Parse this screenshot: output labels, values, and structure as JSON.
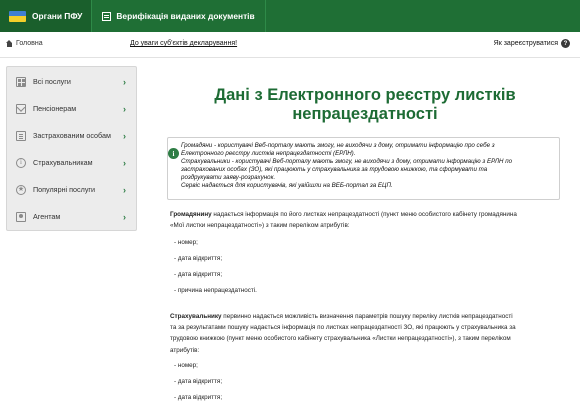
{
  "header": {
    "brand": "Органи ПФУ",
    "nav_item": "Верифікація виданих документів"
  },
  "subbar": {
    "home": "Головна",
    "notice": "До уваги суб'єктів декларування!",
    "register": "Як зареєструватися",
    "help_glyph": "?"
  },
  "sidebar": {
    "items": [
      {
        "label": "Всі послуги",
        "icon": "grid-icon"
      },
      {
        "label": "Пенсіонерам",
        "icon": "envelope-icon"
      },
      {
        "label": "Застрахованим особам",
        "icon": "document-icon"
      },
      {
        "label": "Страхувальникам",
        "icon": "info-icon"
      },
      {
        "label": "Популярні послуги",
        "icon": "star-icon"
      },
      {
        "label": "Агентам",
        "icon": "user-icon"
      }
    ],
    "chevron": "›"
  },
  "main": {
    "title_line1": "Дані з Електронного реєстру листків",
    "title_line2": "непрацездатності",
    "info_icon": "i",
    "info_lines": [
      "Громадяни - користувачі Веб-порталу мають змогу, не виходячи з дому, отримати інформацію про себе з",
      "Електронного реєстру листків непрацездатності (ЕРЛН).",
      "Страхувальники - користувачі Веб-порталу мають змогу, не виходячи з дому, отримати інформацію з ЕРЛН по",
      "застрахованих особах (ЗО), які працюють у страхувальника за трудовою книжкою, та сформувати та",
      "роздрукувати заяву-розрахунок.",
      "Сервіс надається для користувачів, які увійшли на ВЕБ-портал за ЕЦП."
    ],
    "p1_lead": "Громадянину",
    "p1_line1": " надається інформація по його листках непрацездатності (пункт меню особистого кабінету громадянина",
    "p1_line2": "«Мої листки непрацездатності») з таким переліком атрибутів:",
    "p1_items": [
      "- номер;",
      "- дата відкриття;",
      "- дата відкриття;",
      "- причина непрацездатності."
    ],
    "p2_lead": "Страхувальнику",
    "p2_line1": " первинно надається можливість визначення параметрів пошуку переліку листків непрацездатності",
    "p2_line2": "та за результатами пошуку надається інформація по листках непрацездатності ЗО, які працюють у страхувальника за",
    "p2_line3": "трудовою книжкою (пункт меню особистого кабінету страхувальника «Листки непрацездатності»), з таким переліком",
    "p2_line4": "атрибутів:",
    "p2_items": [
      "- номер;",
      "- дата відкриття;",
      "- дата відкриття;"
    ]
  }
}
